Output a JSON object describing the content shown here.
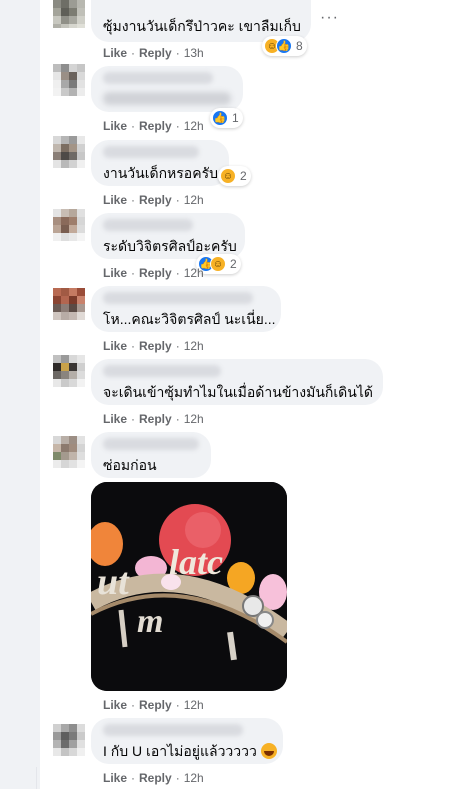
{
  "actions": {
    "like": "Like",
    "reply": "Reply",
    "separator": "·"
  },
  "comments": [
    {
      "text": "ซุ้มงานวันเด็กรึป่าวคะ เขาลืมเก็บ",
      "time": "13h",
      "reactions": [
        "haha",
        "like"
      ],
      "reaction_count": "8"
    },
    {
      "text": "",
      "time": "12h",
      "reactions": [
        "like"
      ],
      "reaction_count": "1"
    },
    {
      "text": "งานวันเด็กหรอครับ",
      "time": "12h",
      "reactions": [
        "haha"
      ],
      "reaction_count": "2"
    },
    {
      "text": "ระดับวิจิตรศิลป์อะครับ",
      "time": "12h",
      "reactions": [
        "like",
        "haha"
      ],
      "reaction_count": "2"
    },
    {
      "text": "โห...คณะวิจิตรศิลป์ นะเนี่ย...",
      "time": "12h"
    },
    {
      "text": "จะเดินเข้าซุ้มทำไมในเมื่อด้านข้างมันก็เดินได้",
      "time": "12h"
    },
    {
      "text": "ซ่อมก่อน",
      "time": "12h"
    },
    {
      "image": true,
      "time": "12h"
    },
    {
      "text": "I กับ U เอาไม่อยู่แล้ววววว",
      "emoji": "haha",
      "time": "12h"
    }
  ],
  "icons": {
    "more": "more-options-icon",
    "like": "like-reaction-icon",
    "haha": "haha-reaction-icon"
  },
  "colors": {
    "bubble": "#f0f2f5",
    "meta_text": "#65676b",
    "like_blue": "#1877f2",
    "haha_yellow": "#f7b125"
  }
}
